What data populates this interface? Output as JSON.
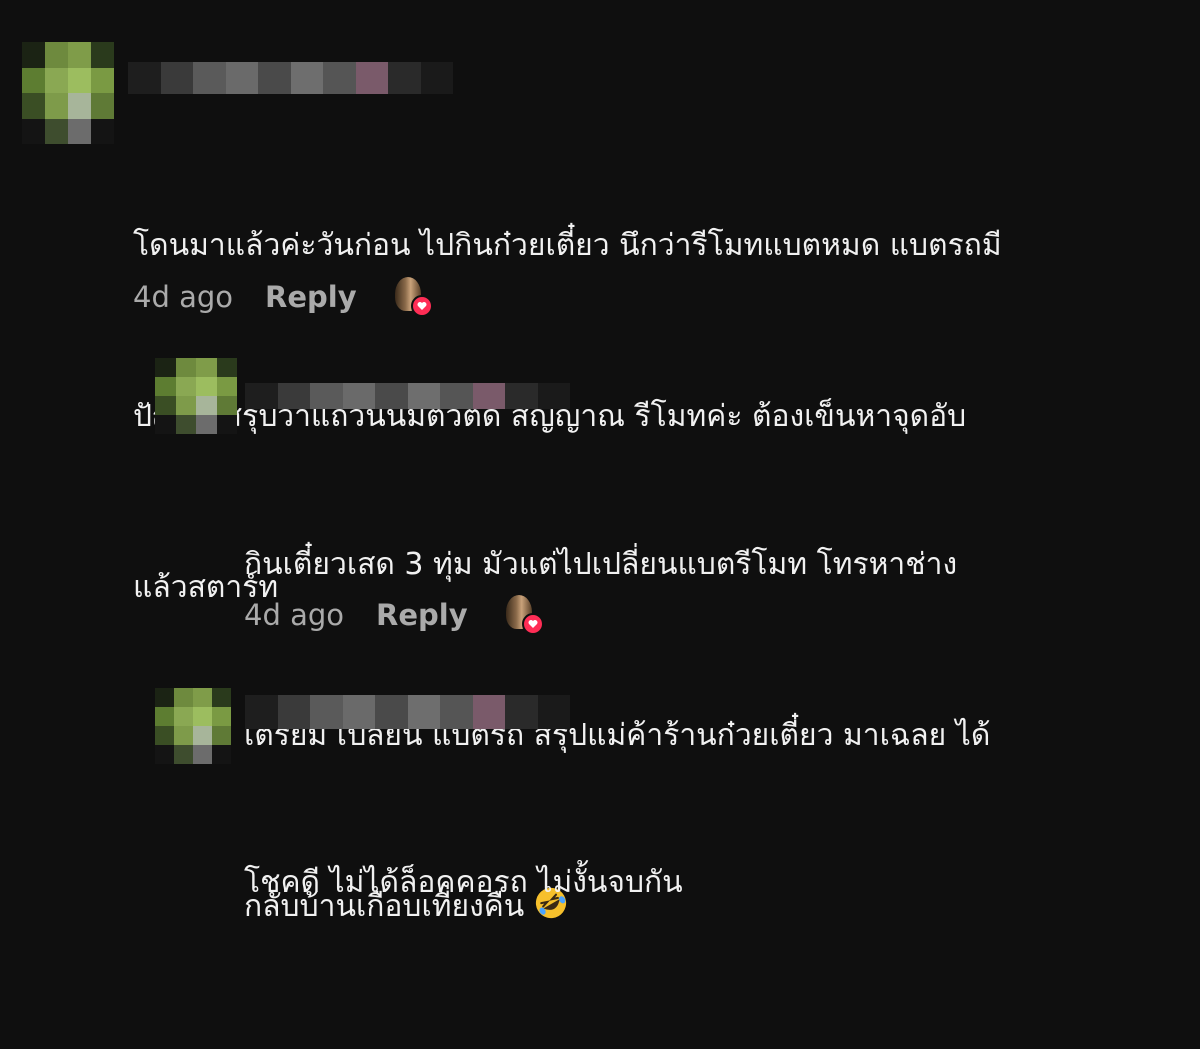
{
  "comments": [
    {
      "text_lines": [
        "โดนมาแล้วค่ะวันก่อน ไปกินก๋วยเตี๋ยว นึกว่ารีโมทแบตหมด แบตรถมี",
        "ปัญหา สรุปว่าแถวนั้นมีตัวตัด สัญญาณ รีโมทค่ะ ต้องเข็นหาจุดอับ",
        "แล้วสตาร์ท"
      ],
      "time": "4d ago",
      "reply_label": "Reply"
    },
    {
      "text_lines": [
        "กินเตี๋ยวเสด 3 ทุ่ม มัวแต่ไปเปลี่ยนแบตรีโมท โทรหาช่าง",
        "เตรียม เปลี่ยน แบตรถ สรุปแม่ค้าร้านก๋วยเตี๋ยว มาเฉลย ได้",
        "กลับบ้านเกือบเที่ยงคืน"
      ],
      "time": "4d ago",
      "reply_label": "Reply",
      "emoji": "rolling-on-floor-laughing-emoji"
    },
    {
      "text_lines": [
        "โชคดี ไม่ได้ล็อคคอรถ ไม่งั้นจบกัน"
      ]
    }
  ],
  "colors": {
    "background": "#0f0f0f",
    "text": "#f1f1f1",
    "muted": "#aaaaaa",
    "heart_badge": "#ff2d55"
  }
}
